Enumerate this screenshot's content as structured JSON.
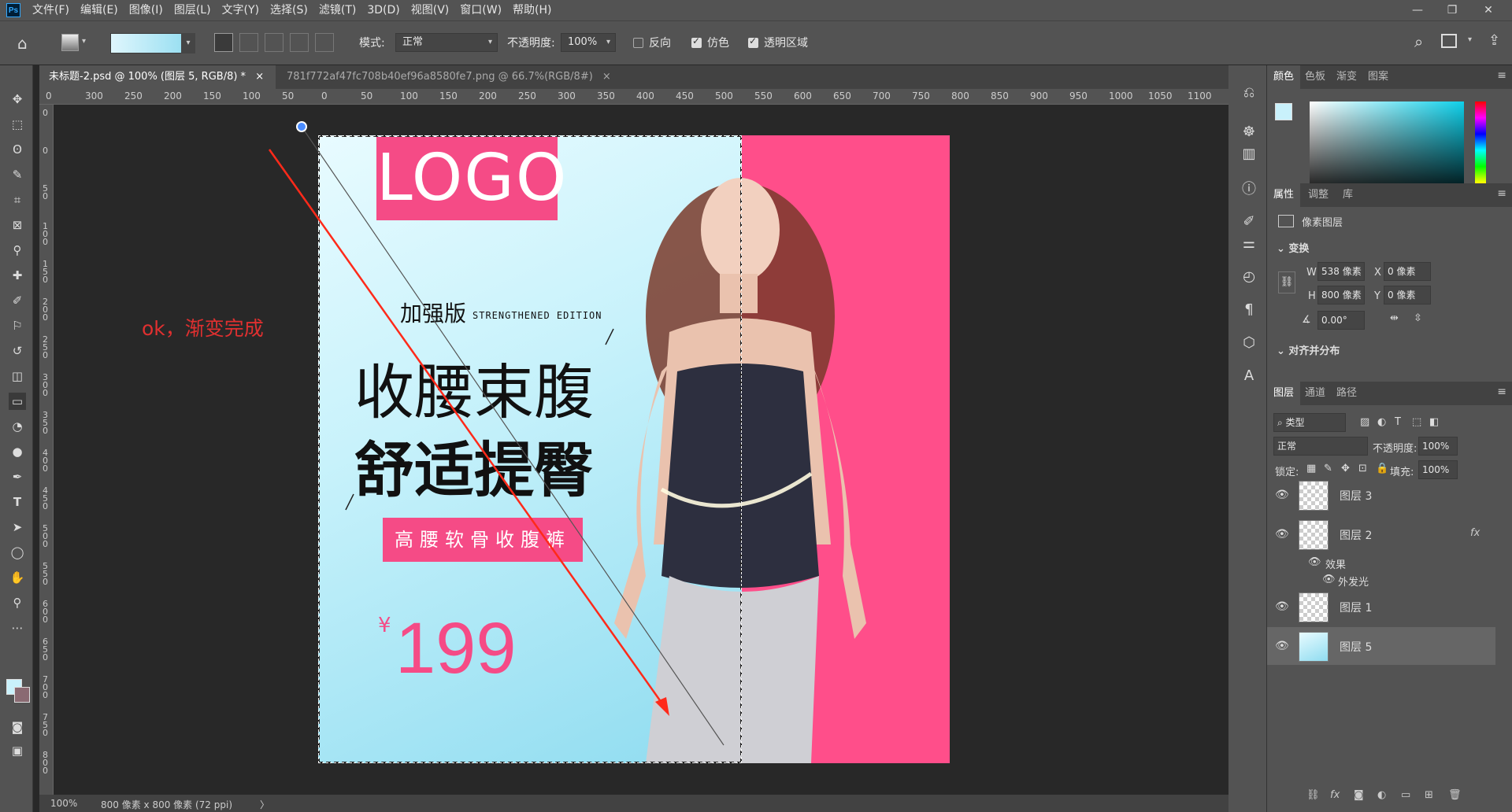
{
  "menubar": {
    "logo": "Ps",
    "items": [
      "文件(F)",
      "编辑(E)",
      "图像(I)",
      "图层(L)",
      "文字(Y)",
      "选择(S)",
      "滤镜(T)",
      "3D(D)",
      "视图(V)",
      "窗口(W)",
      "帮助(H)"
    ],
    "controls": {
      "minimize": "—",
      "restore": "❐",
      "close": "✕"
    }
  },
  "options": {
    "mode_label": "模式:",
    "mode_value": "正常",
    "opacity_label": "不透明度:",
    "opacity_value": "100%",
    "reverse_label": "反向",
    "dither_label": "仿色",
    "transparency_label": "透明区域"
  },
  "tabs": [
    {
      "label": "未标题-2.psd @ 100% (图层 5, RGB/8) *",
      "close": "×"
    },
    {
      "label": "781f772af47fc708b40ef96a8580fe7.png @ 66.7%(RGB/8#)",
      "close": "×"
    }
  ],
  "ruler": {
    "h_ticks": [
      "0",
      "300",
      "250",
      "200",
      "150",
      "100",
      "50",
      "0",
      "50",
      "100",
      "150",
      "200",
      "250",
      "300",
      "350",
      "400",
      "450",
      "500",
      "550",
      "600",
      "650",
      "700",
      "750",
      "800",
      "850",
      "900",
      "950",
      "1000",
      "1050",
      "1100"
    ],
    "v_ticks": [
      "0",
      "0",
      "50",
      "100",
      "150",
      "200",
      "250",
      "300",
      "350",
      "400",
      "450",
      "500",
      "550",
      "600",
      "650",
      "700",
      "750",
      "800"
    ]
  },
  "artwork": {
    "logo": "LOGO",
    "plus_cn": "加强版",
    "plus_en": "STRENGTHENED EDITION",
    "headline1": "收腰束腹",
    "headline2": "舒适提臀",
    "tagline": "高腰软骨收腹裤",
    "price_symbol": "¥",
    "price": "199"
  },
  "annotation": "ok，渐变完成",
  "status": {
    "zoom": "100%",
    "info": "800 像素 x 800 像素 (72 ppi)",
    "arrow": "〉"
  },
  "color_panel": {
    "tabs": [
      "颜色",
      "色板",
      "渐变",
      "图案"
    ]
  },
  "properties_panel": {
    "tabs": [
      "属性",
      "调整",
      "库"
    ],
    "kind": "像素图层",
    "transform_title": "变换",
    "w_label": "W",
    "w_value": "538 像素",
    "x_label": "X",
    "x_value": "0 像素",
    "h_label": "H",
    "h_value": "800 像素",
    "y_label": "Y",
    "y_value": "0 像素",
    "angle_value": "0.00°",
    "align_title": "对齐并分布"
  },
  "layers_panel": {
    "tabs": [
      "图层",
      "通道",
      "路径"
    ],
    "filter_label": "类型",
    "blend_value": "正常",
    "opacity_label": "不透明度:",
    "opacity_value": "100%",
    "lock_label": "锁定:",
    "fill_label": "填充:",
    "fill_value": "100%",
    "layers": [
      {
        "name": "图层 3"
      },
      {
        "name": "图层 2",
        "fx": "fx",
        "effects_label": "效果",
        "effect": "外发光"
      },
      {
        "name": "图层 1"
      },
      {
        "name": "图层 5"
      }
    ]
  },
  "colors": {
    "accent_pink": "#f54b86",
    "right_bg": "#ff4e8a",
    "annotation_red": "#e03030"
  }
}
